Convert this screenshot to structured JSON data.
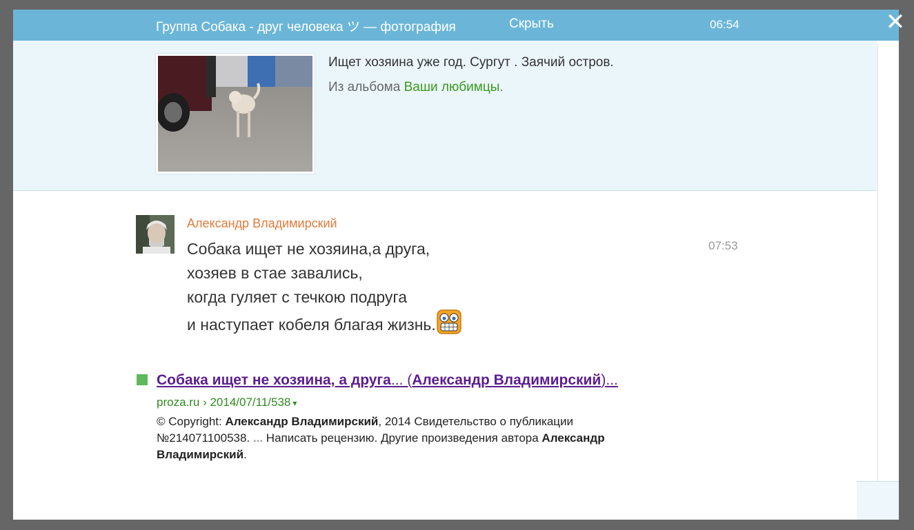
{
  "header": {
    "title": "Группа Собака - друг человека ツ — фотография",
    "hide_label": "Скрыть",
    "time": "06:54",
    "close_glyph": "✕"
  },
  "photo": {
    "description": "Ищет хозяина уже год. Сургут . Заячий остров.",
    "album_prefix": "Из альбома ",
    "album_name": "Ваши любимцы."
  },
  "comment": {
    "author": "Александр Владимирский",
    "time": "07:53",
    "lines": [
      "Собака ищет не хозяина,а друга,",
      "хозяев в стае завались,",
      "когда гуляет с течкою подруга",
      "и наступает кобеля благая жизнь."
    ]
  },
  "search_result": {
    "title_part1": "Собака ищет не хозяина, а друга",
    "title_ellipsis1": "... (",
    "title_part2": "Александр Владимирский",
    "title_ellipsis2": ")...",
    "url": "proza.ru › 2014/07/11/538",
    "url_arrow": "▾",
    "snippet_1": "© Copyright: ",
    "snippet_bold_1": "Александр Владимирский",
    "snippet_2": ", 2014 Свидетельство о публикации №214071100538. ",
    "snippet_ell": "...",
    "snippet_3": " Написать рецензию. Другие произведения автора ",
    "snippet_bold_2": "Александр Владимирский",
    "snippet_4": "."
  },
  "colors": {
    "header_bg": "#6bb6d8",
    "panel_bg": "#ebf6fb",
    "author": "#e07b39",
    "album_link": "#3b9a1b",
    "result_link": "#5b1d8e",
    "result_url": "#2f8a1f"
  }
}
